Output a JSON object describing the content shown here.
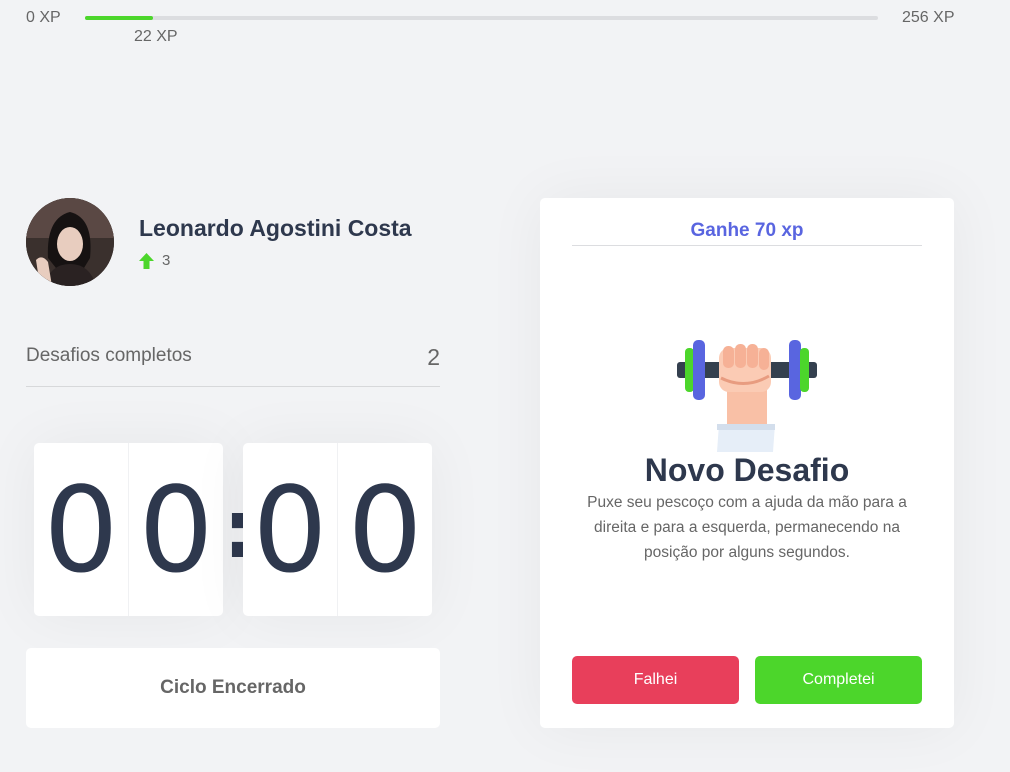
{
  "xp_bar": {
    "min_label": "0 XP",
    "max_label": "256 XP",
    "current_label": "22 XP",
    "progress_fraction": 0.086
  },
  "profile": {
    "name": "Leonardo Agostini Costa",
    "level": "3",
    "level_icon": "level-up-arrow-icon",
    "level_icon_color": "#4cd62b"
  },
  "completed_challenges": {
    "label": "Desafios completos",
    "value": "2"
  },
  "countdown": {
    "minute_left": "0",
    "minute_right": "0",
    "separator": ":",
    "second_left": "0",
    "second_right": "0"
  },
  "cycle_button": {
    "label": "Ciclo Encerrado"
  },
  "challenge": {
    "header": "Ganhe 70 xp",
    "illustration_icon": "dumbbell-icon",
    "title": "Novo Desafio",
    "description": "Puxe seu pescoço com a ajuda da mão para a direita e para a esquerda, permanecendo na posição por alguns segundos.",
    "fail_label": "Falhei",
    "success_label": "Completei"
  },
  "colors": {
    "background": "#f2f3f5",
    "accent_blue": "#5965e0",
    "green": "#4cd62b",
    "red": "#e83f5b",
    "title": "#2e384d",
    "text": "#666666"
  }
}
